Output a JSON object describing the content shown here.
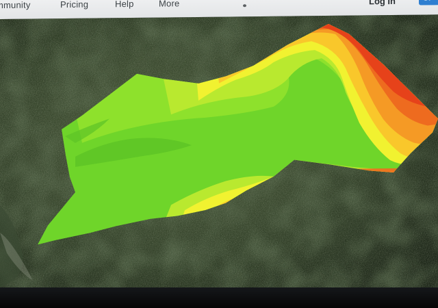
{
  "nav": {
    "items": [
      {
        "label": "mmunity"
      },
      {
        "label": "Pricing"
      },
      {
        "label": "Help"
      },
      {
        "label": "More"
      }
    ],
    "login_label": "Log In",
    "signup_label": "Si"
  },
  "map": {
    "basemap": "satellite-imagery",
    "overlay": "elevation-heatmap",
    "overlay_colors": [
      "#6fd52a",
      "#8ee12c",
      "#b9e92f",
      "#f1f230",
      "#f9c72b",
      "#f59a25",
      "#ee6b1f",
      "#e6421a"
    ]
  }
}
